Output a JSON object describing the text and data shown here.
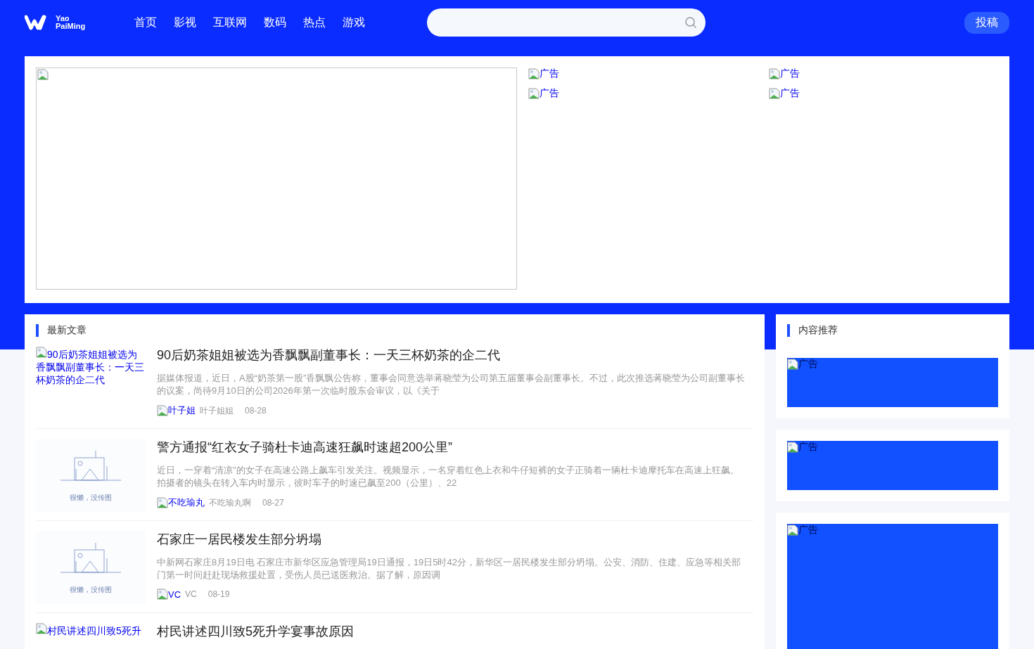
{
  "logo": {
    "line1": "Yao",
    "line2": "PaiMing"
  },
  "nav": [
    "首页",
    "影视",
    "互联网",
    "数码",
    "热点",
    "游戏"
  ],
  "submit_button": "投稿",
  "banner": {
    "ads": [
      "广告",
      "广告",
      "广告",
      "广告"
    ]
  },
  "latest": {
    "title": "最新文章",
    "articles": [
      {
        "thumb": {
          "kind": "broken",
          "alt": "90后奶茶姐姐被选为香飘飘副董事长：一天三杯奶茶的企二代"
        },
        "title": "90后奶茶姐姐被选为香飘飘副董事长：一天三杯奶茶的企二代",
        "summary": "据媒体报道，近日，A股“奶茶第一股”香飘飘公告称，董事会同意选举蒋晓莹为公司第五届董事会副董事长。不过，此次推选蒋晓莹为公司副董事长的议案，尚待9月10日的公司2026年第一次临时股东会审议，以《关于",
        "avatar_alt": "叶子姐",
        "author": "叶子姐姐",
        "date": "08-28"
      },
      {
        "thumb": {
          "kind": "placeholder",
          "caption": "很懒，没传图"
        },
        "title": "警方通报“红衣女子骑杜卡迪高速狂飙时速超200公里”",
        "summary": "近日，一穿着“清凉”的女子在高速公路上飙车引发关注。视频显示，一名穿着红色上衣和牛仔短裤的女子正骑着一辆杜卡迪摩托车在高速上狂飙。拍摄者的镜头在转入车内时显示，彼时车子的时速已飙至200（公里）、22",
        "avatar_alt": "不吃瑜丸",
        "author": "不吃瑜丸啊",
        "date": "08-27"
      },
      {
        "thumb": {
          "kind": "placeholder",
          "caption": "很懒，没传图"
        },
        "title": "石家庄一居民楼发生部分坍塌",
        "summary": "中新网石家庄8月19日电 石家庄市新华区应急管理局19日通报，19日5时42分，新华区一居民楼发生部分坍塌。公安、消防、住建、应急等相关部门第一时间赶赴现场救援处置，受伤人员已送医救治。据了解，原因调",
        "avatar_alt": "VC",
        "author": "VC",
        "date": "08-19"
      },
      {
        "thumb": {
          "kind": "broken",
          "alt": "村民讲述四川致5死升"
        },
        "title": "村民讲述四川致5死升学宴事故原因"
      }
    ]
  },
  "recommend": {
    "title": "内容推荐",
    "ads": [
      {
        "alt": "广告",
        "kind": "banner"
      },
      {
        "alt": "广告",
        "kind": "banner"
      },
      {
        "alt": "广告",
        "kind": "tall"
      }
    ]
  }
}
